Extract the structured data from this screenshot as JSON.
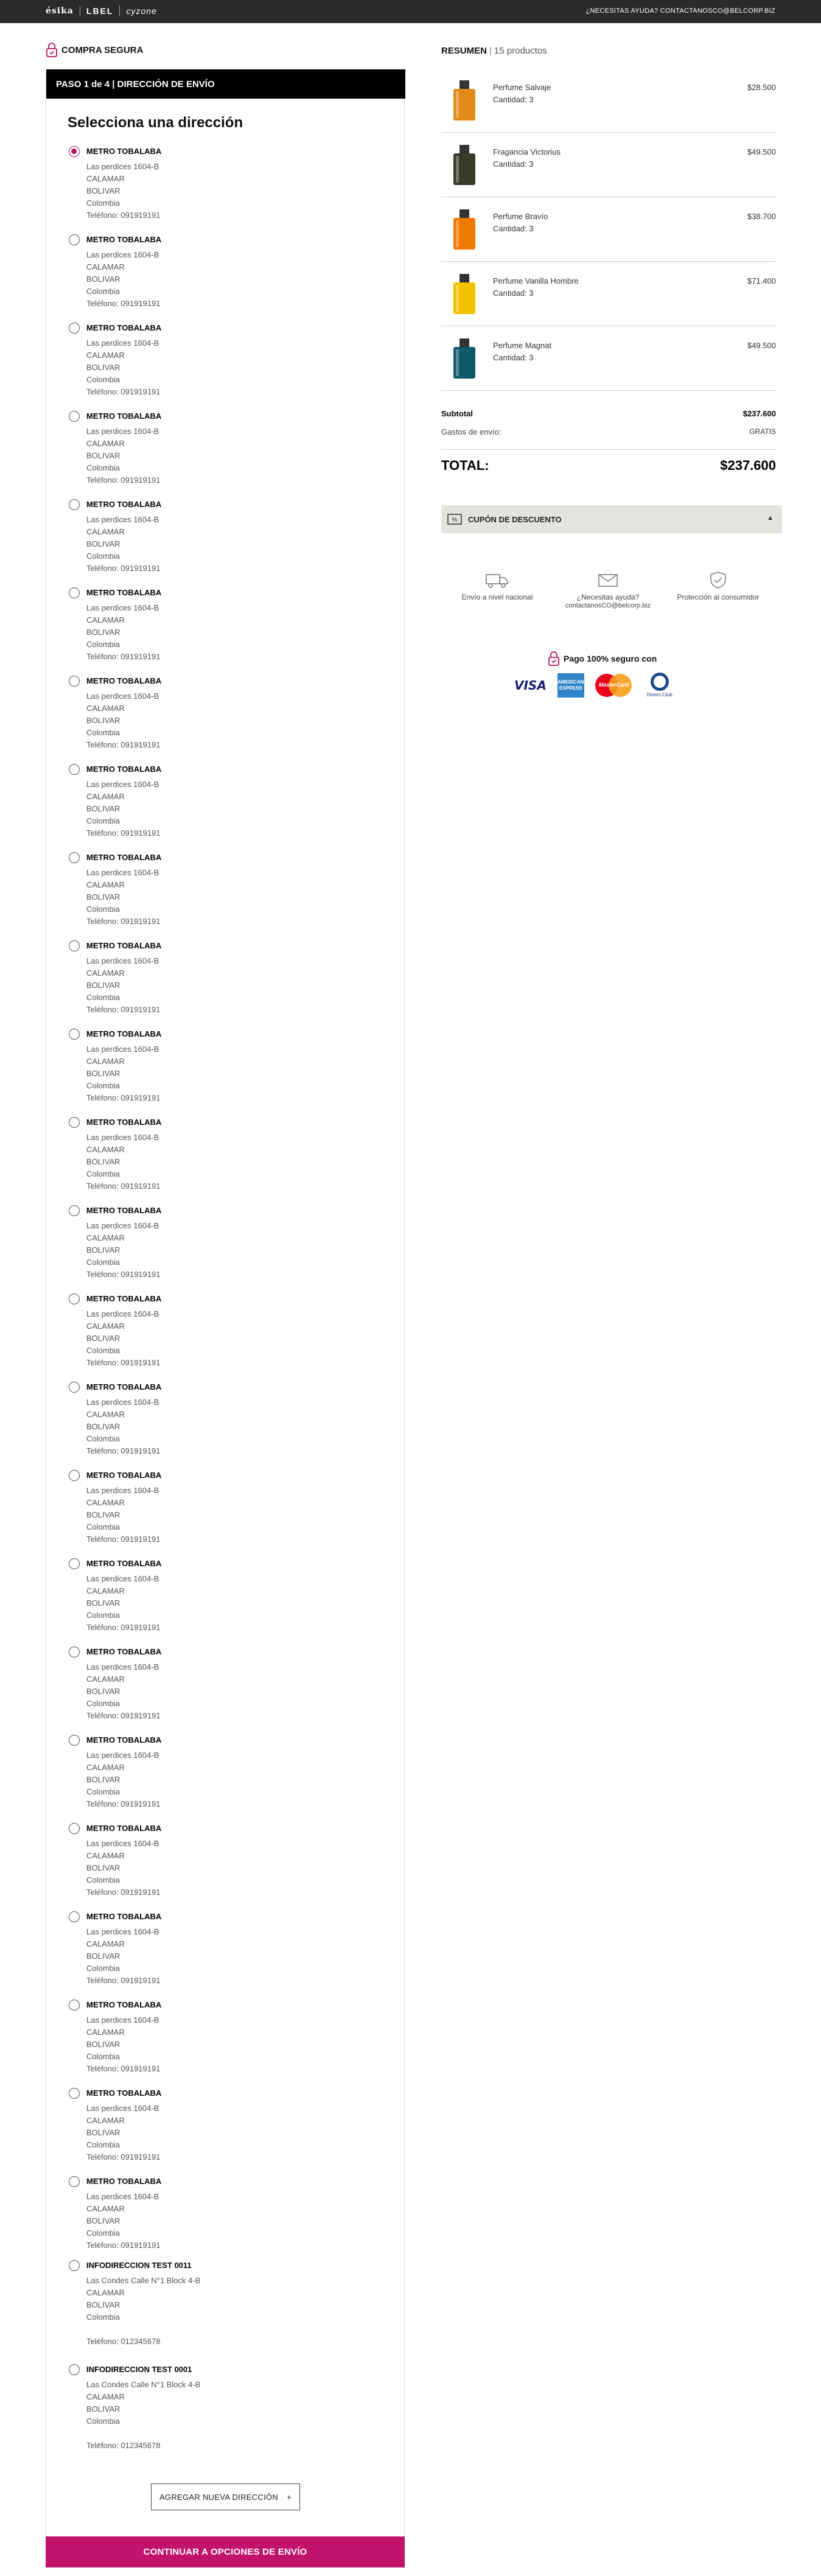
{
  "topbar": {
    "brands": [
      "ésika",
      "LBEL",
      "cyzone"
    ],
    "help_text": "¿NECESITAS AYUDA? CONTACTANOSCO@BELCORP.BIZ"
  },
  "secure_label": "COMPRA SEGURA",
  "step": {
    "label": "PASO 1 de 4 | DIRECCIÓN DE ENVÍO"
  },
  "address_heading": "Selecciona una dirección",
  "addresses": [
    {
      "name": "METRO TOBALABA",
      "street": "Las perdices 1604-B",
      "city": "CALAMAR",
      "state": "BOLIVAR",
      "country": "Colombia",
      "phone": "Teléfono: 091919191",
      "selected": true
    },
    {
      "name": "METRO TOBALABA",
      "street": "Las perdices 1604-B",
      "city": "CALAMAR",
      "state": "BOLIVAR",
      "country": "Colombia",
      "phone": "Teléfono: 091919191",
      "selected": false
    },
    {
      "name": "METRO TOBALABA",
      "street": "Las perdices 1604-B",
      "city": "CALAMAR",
      "state": "BOLIVAR",
      "country": "Colombia",
      "phone": "Teléfono: 091919191",
      "selected": false
    },
    {
      "name": "METRO TOBALABA",
      "street": "Las perdices 1604-B",
      "city": "CALAMAR",
      "state": "BOLIVAR",
      "country": "Colombia",
      "phone": "Teléfono: 091919191",
      "selected": false
    },
    {
      "name": "METRO TOBALABA",
      "street": "Las perdices 1604-B",
      "city": "CALAMAR",
      "state": "BOLIVAR",
      "country": "Colombia",
      "phone": "Teléfono: 091919191",
      "selected": false
    },
    {
      "name": "METRO TOBALABA",
      "street": "Las perdices 1604-B",
      "city": "CALAMAR",
      "state": "BOLIVAR",
      "country": "Colombia",
      "phone": "Teléfono: 091919191",
      "selected": false
    },
    {
      "name": "METRO TOBALABA",
      "street": "Las perdices 1604-B",
      "city": "CALAMAR",
      "state": "BOLIVAR",
      "country": "Colombia",
      "phone": "Teléfono: 091919191",
      "selected": false
    },
    {
      "name": "METRO TOBALABA",
      "street": "Las perdices 1604-B",
      "city": "CALAMAR",
      "state": "BOLIVAR",
      "country": "Colombia",
      "phone": "Teléfono: 091919191",
      "selected": false
    },
    {
      "name": "METRO TOBALABA",
      "street": "Las perdices 1604-B",
      "city": "CALAMAR",
      "state": "BOLIVAR",
      "country": "Colombia",
      "phone": "Teléfono: 091919191",
      "selected": false
    },
    {
      "name": "METRO TOBALABA",
      "street": "Las perdices 1604-B",
      "city": "CALAMAR",
      "state": "BOLIVAR",
      "country": "Colombia",
      "phone": "Teléfono: 091919191",
      "selected": false
    },
    {
      "name": "METRO TOBALABA",
      "street": "Las perdices 1604-B",
      "city": "CALAMAR",
      "state": "BOLIVAR",
      "country": "Colombia",
      "phone": "Teléfono: 091919191",
      "selected": false
    },
    {
      "name": "METRO TOBALABA",
      "street": "Las perdices 1604-B",
      "city": "CALAMAR",
      "state": "BOLIVAR",
      "country": "Colombia",
      "phone": "Teléfono: 091919191",
      "selected": false
    },
    {
      "name": "METRO TOBALABA",
      "street": "Las perdices 1604-B",
      "city": "CALAMAR",
      "state": "BOLIVAR",
      "country": "Colombia",
      "phone": "Teléfono: 091919191",
      "selected": false
    },
    {
      "name": "METRO TOBALABA",
      "street": "Las perdices 1604-B",
      "city": "CALAMAR",
      "state": "BOLIVAR",
      "country": "Colombia",
      "phone": "Teléfono: 091919191",
      "selected": false
    },
    {
      "name": "METRO TOBALABA",
      "street": "Las perdices 1604-B",
      "city": "CALAMAR",
      "state": "BOLIVAR",
      "country": "Colombia",
      "phone": "Teléfono: 091919191",
      "selected": false
    },
    {
      "name": "METRO TOBALABA",
      "street": "Las perdices 1604-B",
      "city": "CALAMAR",
      "state": "BOLIVAR",
      "country": "Colombia",
      "phone": "Teléfono: 091919191",
      "selected": false
    },
    {
      "name": "METRO TOBALABA",
      "street": "Las perdices 1604-B",
      "city": "CALAMAR",
      "state": "BOLIVAR",
      "country": "Colombia",
      "phone": "Teléfono: 091919191",
      "selected": false
    },
    {
      "name": "METRO TOBALABA",
      "street": "Las perdices 1604-B",
      "city": "CALAMAR",
      "state": "BOLIVAR",
      "country": "Colombia",
      "phone": "Teléfono: 091919191",
      "selected": false
    },
    {
      "name": "METRO TOBALABA",
      "street": "Las perdices 1604-B",
      "city": "CALAMAR",
      "state": "BOLIVAR",
      "country": "Colombia",
      "phone": "Teléfono: 091919191",
      "selected": false
    },
    {
      "name": "METRO TOBALABA",
      "street": "Las perdices 1604-B",
      "city": "CALAMAR",
      "state": "BOLIVAR",
      "country": "Colombia",
      "phone": "Teléfono: 091919191",
      "selected": false
    },
    {
      "name": "METRO TOBALABA",
      "street": "Las perdices 1604-B",
      "city": "CALAMAR",
      "state": "BOLIVAR",
      "country": "Colombia",
      "phone": "Teléfono: 091919191",
      "selected": false
    },
    {
      "name": "METRO TOBALABA",
      "street": "Las perdices 1604-B",
      "city": "CALAMAR",
      "state": "BOLIVAR",
      "country": "Colombia",
      "phone": "Teléfono: 091919191",
      "selected": false
    },
    {
      "name": "METRO TOBALABA",
      "street": "Las perdices 1604-B",
      "city": "CALAMAR",
      "state": "BOLIVAR",
      "country": "Colombia",
      "phone": "Teléfono: 091919191",
      "selected": false
    },
    {
      "name": "METRO TOBALABA",
      "street": "Las perdices 1604-B",
      "city": "CALAMAR",
      "state": "BOLIVAR",
      "country": "Colombia",
      "phone": "Teléfono: 091919191",
      "selected": false
    },
    {
      "name": "INFODIRECCION TEST 0011",
      "street": "Las Condes Calle N°1 Block 4-B",
      "city": "CALAMAR",
      "state": "BOLIVAR",
      "country": "Colombia",
      "phone": "Teléfono: 012345678",
      "selected": false
    },
    {
      "name": "INFODIRECCION TEST 0001",
      "street": "Las Condes Calle N°1 Block 4-B",
      "city": "CALAMAR",
      "state": "BOLIVAR",
      "country": "Colombia",
      "phone": "Teléfono: 012345678",
      "selected": false
    }
  ],
  "buttons": {
    "add_address": "AGREGAR NUEVA DIRECCIÓN",
    "add_address_plus": "+",
    "continue": "CONTINUAR A OPCIONES DE ENVÍO"
  },
  "summary": {
    "title": "RESUMEN",
    "count": "15 productos",
    "products": [
      {
        "name": "Perfume Salvaje",
        "qty": "Cantidad: 3",
        "price": "$28.500",
        "color": "#e08a1a"
      },
      {
        "name": "Fragancia Victorius",
        "qty": "Cantidad: 3",
        "price": "$49.500",
        "color": "#3a3a2a"
      },
      {
        "name": "Perfume Bravío",
        "qty": "Cantidad: 3",
        "price": "$38.700",
        "color": "#f07a00"
      },
      {
        "name": "Perfume Vanilla Hombre",
        "qty": "Cantidad: 3",
        "price": "$71.400",
        "color": "#f2c200"
      },
      {
        "name": "Perfume Magnat",
        "qty": "Cantidad: 3",
        "price": "$49.500",
        "color": "#0f5a6a"
      }
    ],
    "subtotal_label": "Subtotal",
    "subtotal_value": "$237.600",
    "shipping_label": "Gastos de envío:",
    "shipping_value": "GRATIS",
    "total_label": "TOTAL:",
    "total_value": "$237.600"
  },
  "coupon": {
    "label": "CUPÓN DE DESCUENTO",
    "toggle": "▲"
  },
  "benefits": {
    "shipping": "Envío a nivel nacional",
    "help_title": "¿Necesitas ayuda?",
    "help_email": "contactanosCO@belcorp.biz",
    "protection": "Protección al consumidor"
  },
  "payment": {
    "title": "Pago 100% seguro con",
    "visa": "VISA",
    "amex": "AMERICAN EXPRESS",
    "mastercard": "MasterCard",
    "diners": "Diners Club"
  },
  "colors": {
    "accent": "#c1136b",
    "header_bg": "#000000",
    "topbar_bg": "#2b2b2b",
    "coupon_bg": "#e4e3df"
  }
}
